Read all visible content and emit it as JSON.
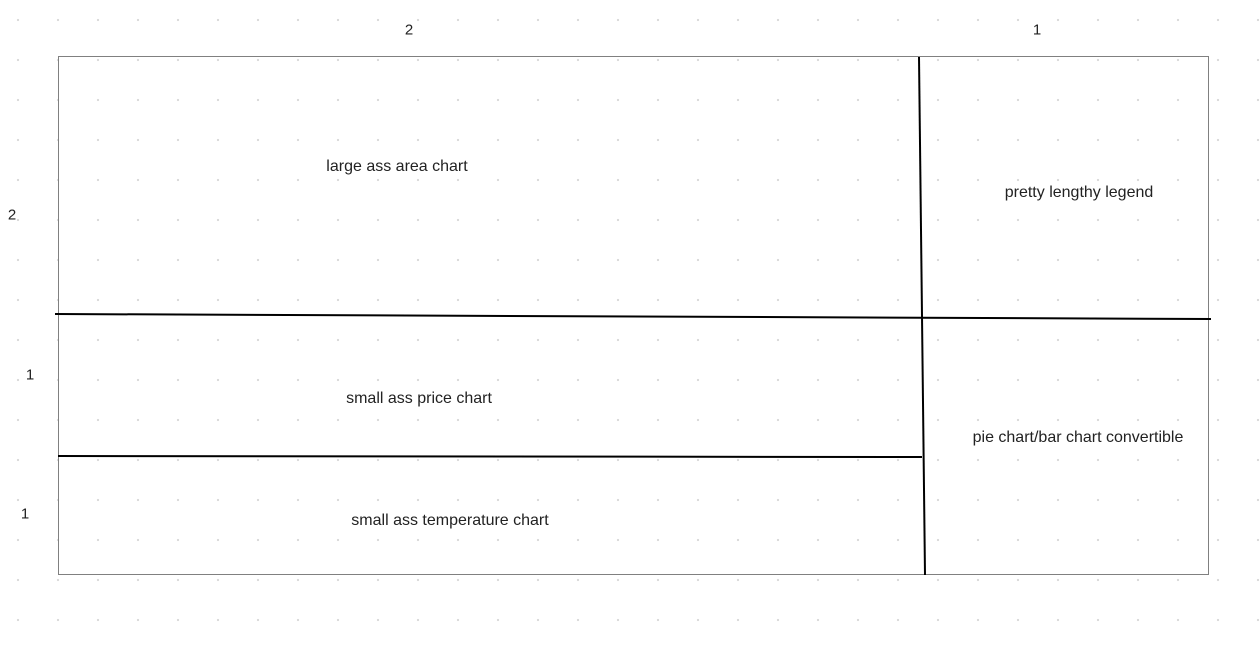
{
  "column_ratios": [
    "2",
    "1"
  ],
  "row_ratios": [
    "2",
    "1",
    "1"
  ],
  "panels": {
    "area_chart": "large ass area chart",
    "legend": "pretty lengthy legend",
    "price_chart": "small ass price chart",
    "pie_bar_chart": "pie chart/bar chart convertible",
    "temperature_chart": "small ass temperature chart"
  }
}
